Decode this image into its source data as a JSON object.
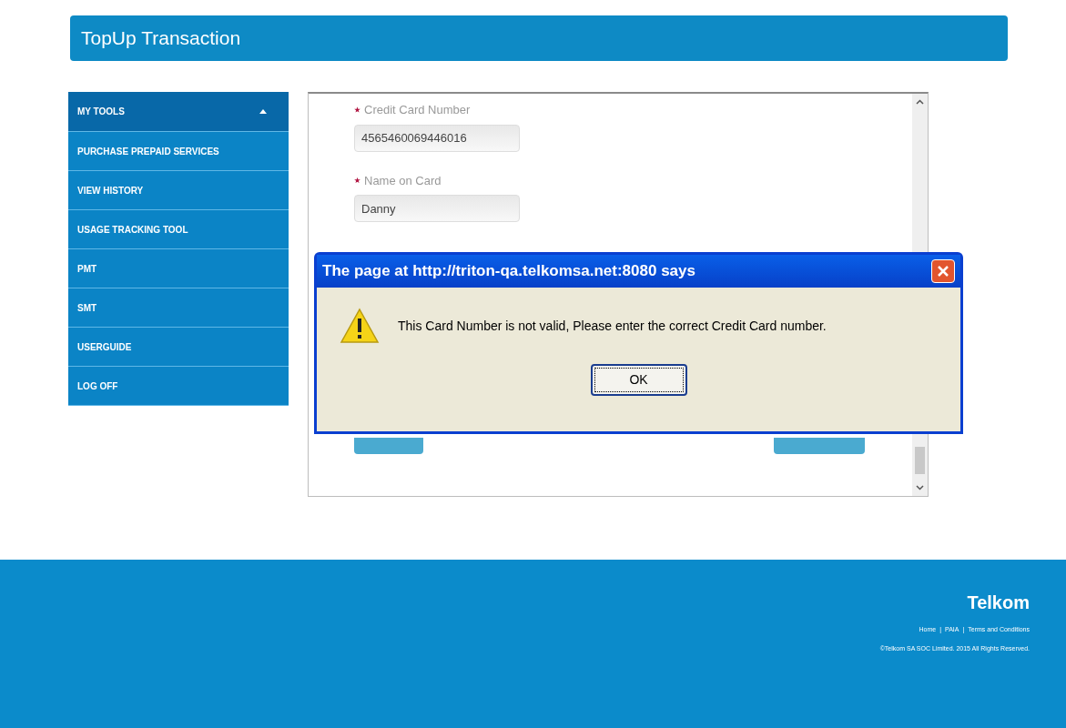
{
  "page_title": "TopUp Transaction",
  "sidebar": {
    "header": {
      "label": "MY TOOLS",
      "expanded": true
    },
    "items": [
      {
        "label": "PURCHASE PREPAID SERVICES"
      },
      {
        "label": "VIEW HISTORY"
      },
      {
        "label": "USAGE TRACKING TOOL"
      },
      {
        "label": "PMT"
      },
      {
        "label": "SMT"
      },
      {
        "label": "USERGUIDE"
      },
      {
        "label": "LOG OFF"
      }
    ]
  },
  "form": {
    "fields": [
      {
        "label": "Credit Card Number",
        "required": true,
        "value": "4565460069446016"
      },
      {
        "label": "Name on Card",
        "required": true,
        "value": "Danny"
      }
    ]
  },
  "dialog": {
    "title": "The page at http://triton-qa.telkomsa.net:8080 says",
    "message": "This Card Number is not valid, Please enter the correct Credit Card number.",
    "button": "OK"
  },
  "footer": {
    "brand": "Telkom",
    "links": [
      "Home",
      "PAIA",
      "Terms and Conditions"
    ],
    "separator": "|",
    "copyright": "©Telkom SA SOC Limited. 2015 All Rights Reserved."
  }
}
